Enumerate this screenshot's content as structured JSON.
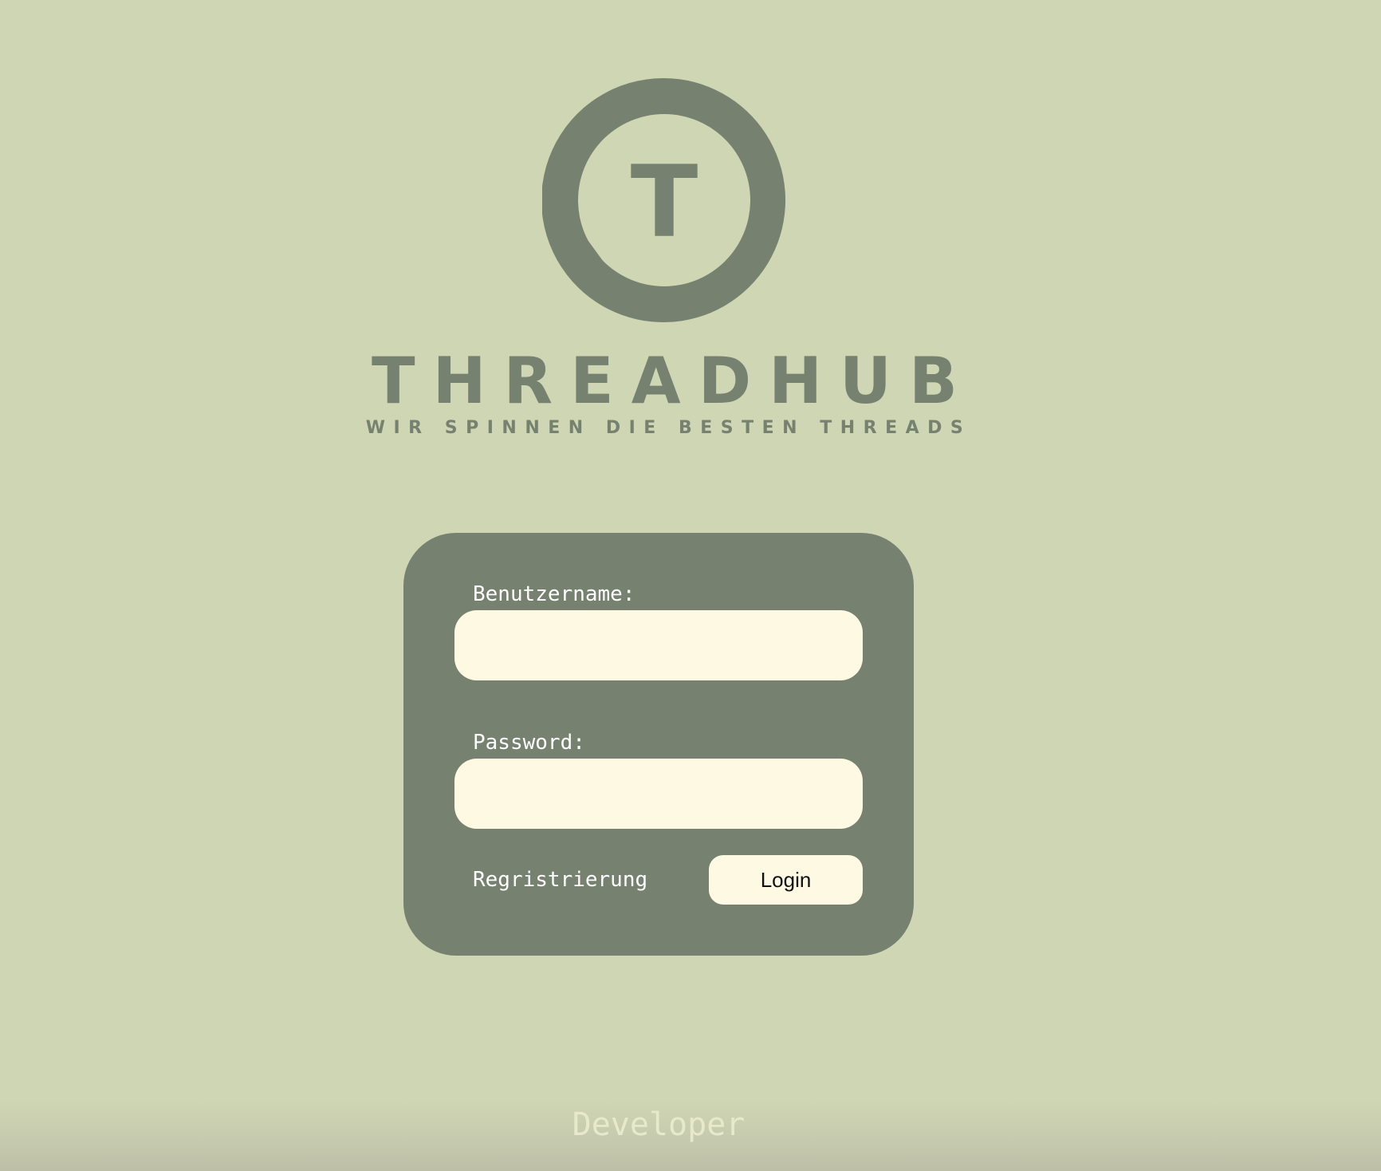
{
  "brand": {
    "name": "THREADHUB",
    "tagline": "WIR SPINNEN DIE BESTEN THREADS",
    "logo_letter": "T",
    "color": "#768170"
  },
  "login_form": {
    "username_label": "Benutzername:",
    "username_value": "",
    "password_label": "Password:",
    "password_value": "",
    "register_label": "Regristrierung",
    "login_label": "Login"
  },
  "footer": {
    "developer_label": "Developer"
  },
  "colors": {
    "background": "#cfd6b3",
    "card": "#768170",
    "input": "#fdf9e3"
  }
}
